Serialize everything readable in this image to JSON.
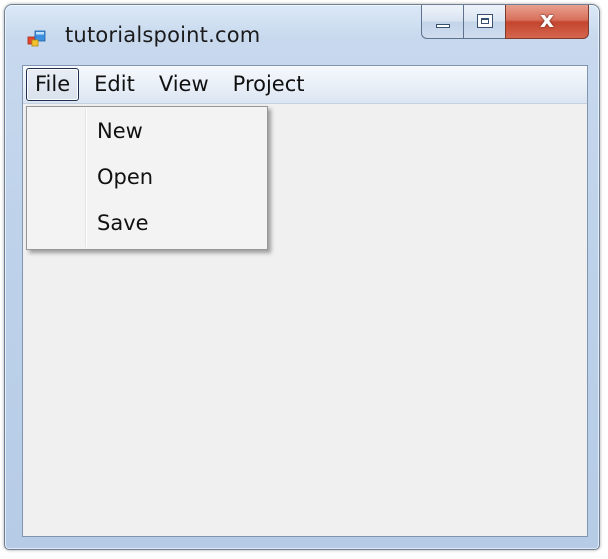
{
  "window": {
    "title": "tutorialspoint.com",
    "icon": "form-app-icon",
    "caption_buttons": {
      "minimize": "minimize-icon",
      "maximize": "maximize-icon",
      "close": "close-icon",
      "close_glyph": "x"
    }
  },
  "menubar": {
    "items": [
      {
        "label": "File",
        "active": true
      },
      {
        "label": "Edit",
        "active": false
      },
      {
        "label": "View",
        "active": false
      },
      {
        "label": "Project",
        "active": false
      }
    ]
  },
  "file_menu": {
    "items": [
      {
        "label": "New"
      },
      {
        "label": "Open"
      },
      {
        "label": "Save"
      }
    ]
  },
  "colors": {
    "client_background": "#f0f0f0",
    "close_button": "#c4452e",
    "frame": "#bed2ea"
  }
}
